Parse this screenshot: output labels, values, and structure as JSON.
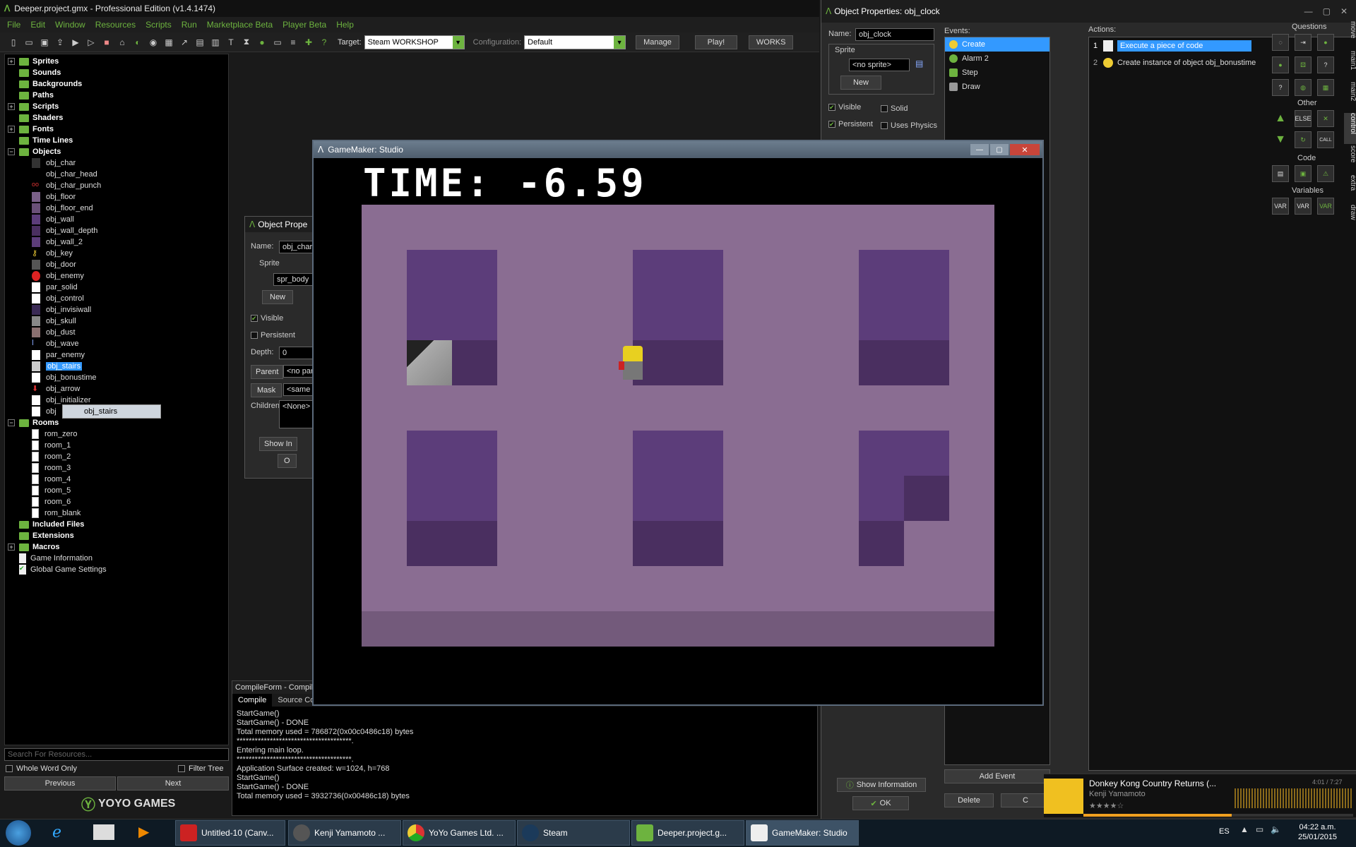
{
  "ide": {
    "title": "Deeper.project.gmx  -  Professional Edition (v1.4.1474)",
    "menu": [
      "File",
      "Edit",
      "Window",
      "Resources",
      "Scripts",
      "Run",
      "Marketplace Beta",
      "Player Beta",
      "Help"
    ],
    "target_label": "Target:",
    "target_value": "Steam WORKSHOP",
    "config_label": "Configuration:",
    "config_value": "Default",
    "manage": "Manage",
    "play": "Play!",
    "works": "WORKS"
  },
  "tree": {
    "folders": [
      "Sprites",
      "Sounds",
      "Backgrounds",
      "Paths",
      "Scripts",
      "Shaders",
      "Fonts",
      "Time Lines"
    ],
    "objects_label": "Objects",
    "objects": [
      "obj_char",
      "obj_char_head",
      "obj_char_punch",
      "obj_floor",
      "obj_floor_end",
      "obj_wall",
      "obj_wall_depth",
      "obj_wall_2",
      "obj_key",
      "obj_door",
      "obj_enemy",
      "par_solid",
      "obj_control",
      "obj_invisiwall",
      "obj_skull",
      "obj_dust",
      "obj_wave",
      "par_enemy",
      "obj_stairs",
      "obj_bonustime",
      "obj_arrow",
      "obj_initializer",
      "obj"
    ],
    "drag_label": "obj_stairs",
    "rooms_label": "Rooms",
    "rooms": [
      "rom_zero",
      "room_1",
      "room_2",
      "room_3",
      "room_4",
      "room_5",
      "room_6",
      "rom_blank"
    ],
    "after": [
      "Included Files",
      "Extensions",
      "Macros"
    ],
    "items": [
      "Game Information",
      "Global Game Settings"
    ],
    "search_placeholder": "Search For Resources...",
    "whole_word": "Whole Word Only",
    "filter_tree": "Filter Tree",
    "previous": "Previous",
    "next": "Next",
    "brand": "YOYO GAMES"
  },
  "charprops": {
    "title": "Object Prope",
    "name_label": "Name:",
    "name_value": "obj_char",
    "sprite_label": "Sprite",
    "sprite_value": "spr_body",
    "new": "New",
    "visible": "Visible",
    "persistent": "Persistent",
    "depth_label": "Depth:",
    "depth_value": "0",
    "parent": "Parent",
    "parent_value": "<no par",
    "mask": "Mask",
    "mask_value": "<same",
    "children_label": "Children:",
    "children_value": "<None>",
    "show_info": "Show In",
    "ok": "O"
  },
  "compile": {
    "title": "CompileForm - Compile",
    "tabs": [
      "Compile",
      "Source Cor"
    ],
    "lines": [
      "StartGame()",
      "StartGame() - DONE",
      "Total memory used = 786872(0x00c0486c18) bytes",
      "**************************************.",
      "Entering main loop.",
      "**************************************.",
      "Application Surface created: w=1024, h=768",
      "StartGame()",
      "StartGame() - DONE",
      "Total memory used = 3932736(0x00486c18) bytes"
    ]
  },
  "clock": {
    "title": "Object Properties: obj_clock",
    "name_label": "Name:",
    "name_value": "obj_clock",
    "sprite_label": "Sprite",
    "sprite_value": "<no sprite>",
    "new": "New",
    "visible": "Visible",
    "solid": "Solid",
    "persistent": "Persistent",
    "uses_physics": "Uses Physics",
    "events_label": "Events:",
    "events": [
      "Create",
      "Alarm 2",
      "Step",
      "Draw"
    ],
    "actions_label": "Actions:",
    "actions": [
      {
        "n": "1",
        "t": "Execute a piece of code"
      },
      {
        "n": "2",
        "t": "Create instance of object obj_bonustime"
      }
    ],
    "show_info": "Show Information",
    "ok": "OK",
    "add_event": "Add Event",
    "delete": "Delete",
    "change": "C",
    "lib_questions": "Questions",
    "lib_other": "Other",
    "lib_code": "Code",
    "lib_variables": "Variables",
    "tabs": [
      "move",
      "main1",
      "main2",
      "control",
      "score",
      "extra",
      "draw"
    ]
  },
  "game": {
    "title": "GameMaker: Studio",
    "time_text": "TIME: -6.59"
  },
  "music": {
    "title": "Donkey Kong Country Returns (...",
    "artist": "Kenji Yamamoto",
    "time": "4:01 / 7:27"
  },
  "taskbar": {
    "tasks": [
      "Untitled-10 (Canv...",
      "Kenji Yamamoto ...",
      "YoYo Games Ltd. ...",
      "Steam",
      "Deeper.project.g...",
      "GameMaker: Studio"
    ],
    "lang": "ES",
    "clock_time": "04:22 a.m.",
    "clock_date": "25/01/2015"
  }
}
